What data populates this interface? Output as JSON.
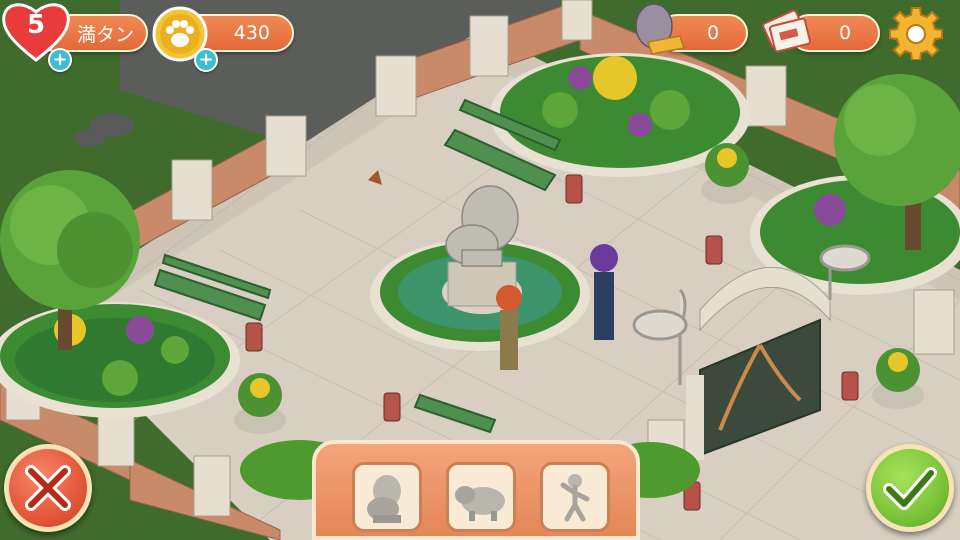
{
  "hud": {
    "lives": {
      "count": "5",
      "status": "満タン",
      "icon": "heart-icon",
      "add_icon": "plus-icon"
    },
    "paws": {
      "amount": "430",
      "icon": "paw-coin-icon",
      "add_icon": "plus-icon"
    },
    "eggs": {
      "amount": "0",
      "icon": "egg-icon"
    },
    "tickets": {
      "amount": "0",
      "icon": "ticket-icon"
    },
    "settings_icon": "gear-icon"
  },
  "buttons": {
    "cancel_icon": "close-icon",
    "confirm_icon": "checkmark-icon"
  },
  "decoration_choices": [
    {
      "icon": "lion-statue-icon"
    },
    {
      "icon": "hippo-statue-icon"
    },
    {
      "icon": "monkey-statue-icon"
    }
  ],
  "colors": {
    "hud_pill": "#e97444",
    "plus_badge": "#3bbfd0",
    "cancel_button": "#e4573a",
    "confirm_button": "#7cc43a",
    "tray": "#ec956a"
  }
}
